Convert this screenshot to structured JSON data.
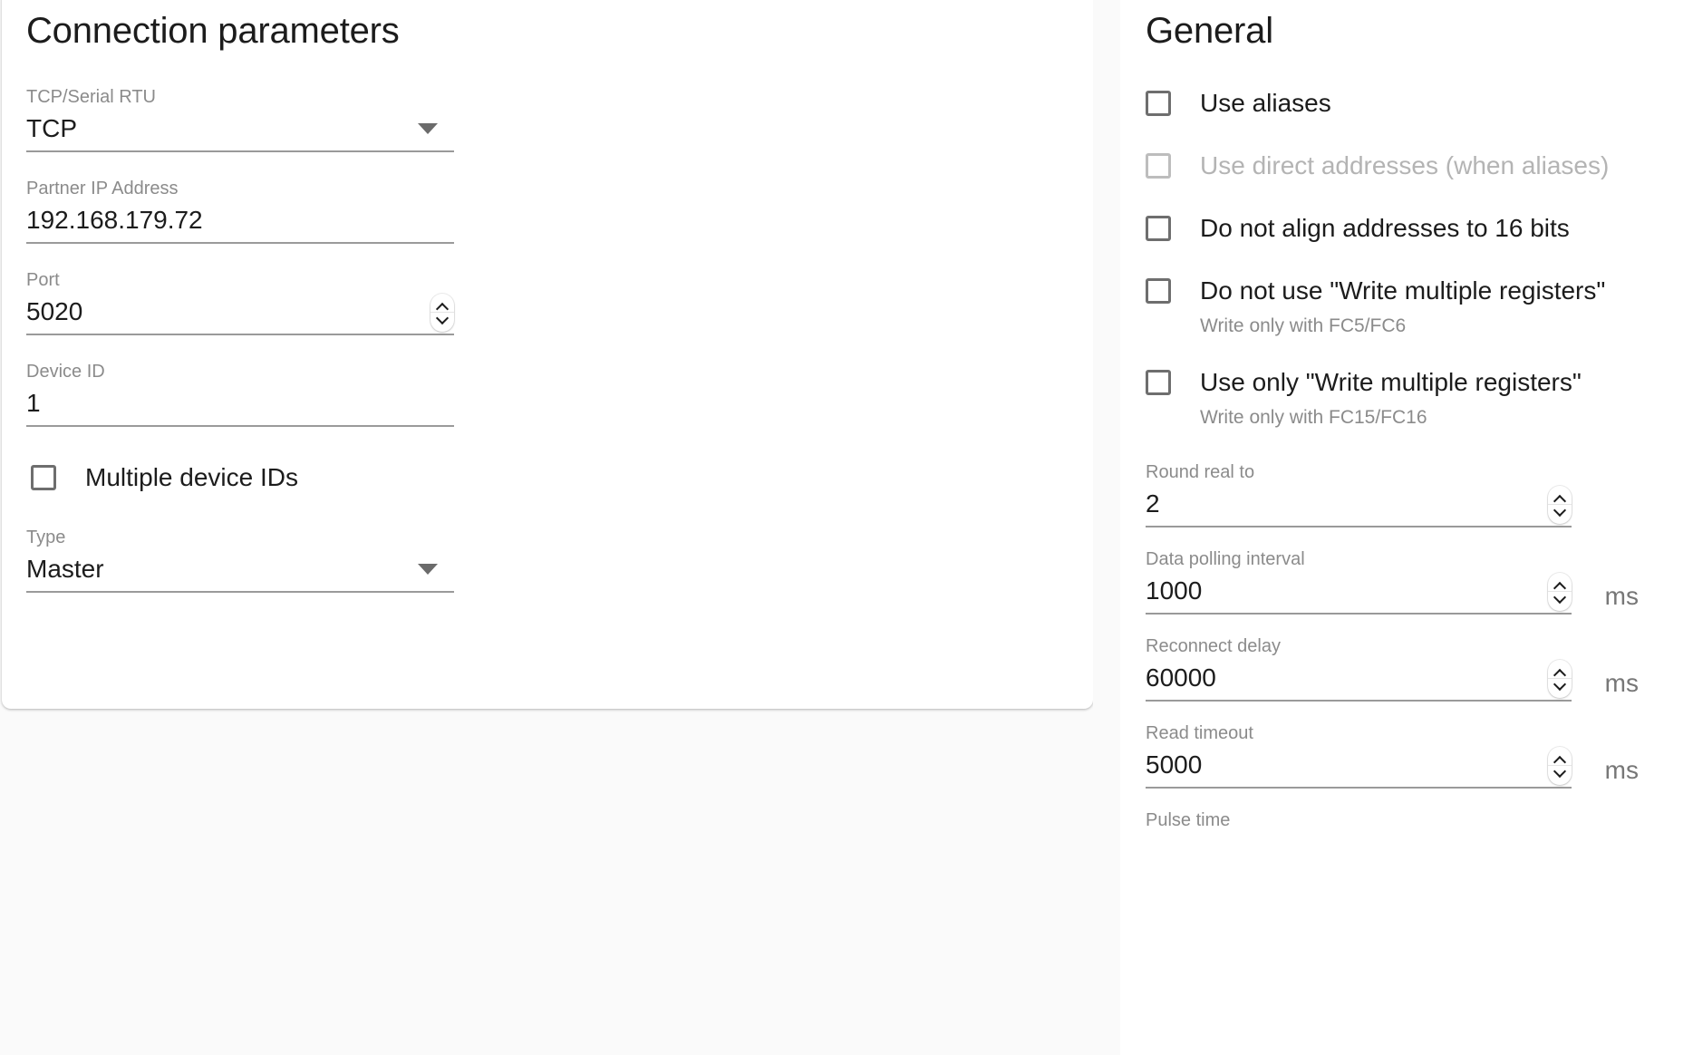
{
  "connection": {
    "title": "Connection parameters",
    "fields": [
      {
        "label": "TCP/Serial RTU",
        "value": "TCP",
        "control": "select"
      },
      {
        "label": "Partner IP Address",
        "value": "192.168.179.72",
        "control": "text"
      },
      {
        "label": "Port",
        "value": "5020",
        "control": "spinner"
      },
      {
        "label": "Device ID",
        "value": "1",
        "control": "text"
      }
    ],
    "multiple_device_ids": {
      "label": "Multiple device IDs",
      "checked": false
    },
    "type_field": {
      "label": "Type",
      "value": "Master",
      "control": "select"
    }
  },
  "general": {
    "title": "General",
    "checkboxes": [
      {
        "label": "Use aliases",
        "checked": false,
        "disabled": false,
        "hint": ""
      },
      {
        "label": "Use direct addresses (when aliases)",
        "checked": false,
        "disabled": true,
        "hint": ""
      },
      {
        "label": "Do not align addresses to 16 bits",
        "checked": false,
        "disabled": false,
        "hint": ""
      },
      {
        "label": "Do not use \"Write multiple registers\"",
        "checked": false,
        "disabled": false,
        "hint": "Write only with FC5/FC6"
      },
      {
        "label": "Use only \"Write multiple registers\"",
        "checked": false,
        "disabled": false,
        "hint": "Write only with FC15/FC16"
      }
    ],
    "numeric_fields": [
      {
        "label": "Round real to",
        "value": "2",
        "unit": ""
      },
      {
        "label": "Data polling interval",
        "value": "1000",
        "unit": "ms"
      },
      {
        "label": "Reconnect delay",
        "value": "60000",
        "unit": "ms"
      },
      {
        "label": "Read timeout",
        "value": "5000",
        "unit": "ms"
      }
    ],
    "pulse_time_label": "Pulse time"
  },
  "colors": {
    "page_background": "#fafafa",
    "card_background": "#ffffff",
    "label_grey": "#8b8b8b",
    "text_dark": "#1c1c1c",
    "underline": "#9a9a9a",
    "disabled_grey": "#b4b4b4"
  }
}
